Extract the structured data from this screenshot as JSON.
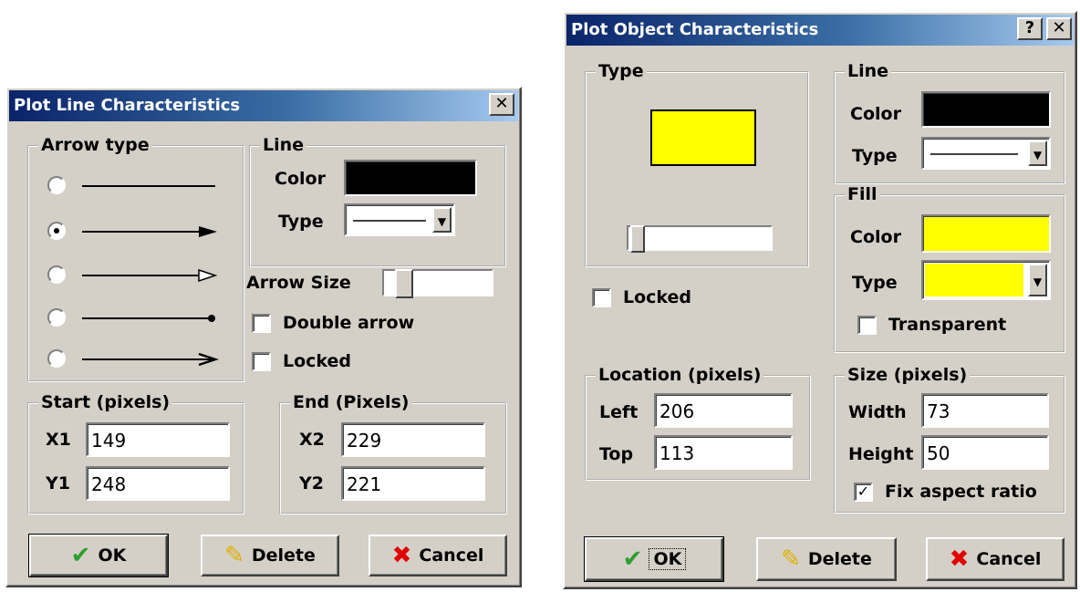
{
  "line_dialog": {
    "title": "Plot Line Characteristics",
    "close_glyph": "✕",
    "arrow_type": {
      "label": "Arrow type",
      "options": [
        "plain",
        "solid-head",
        "open-head",
        "dot-end",
        "barbed-head"
      ],
      "selected_index": 1
    },
    "line": {
      "label": "Line",
      "color_label": "Color",
      "color": "#000000",
      "type_label": "Type"
    },
    "arrow_size_label": "Arrow Size",
    "double_arrow_label": "Double arrow",
    "double_arrow_checked": false,
    "locked_label": "Locked",
    "locked_checked": false,
    "start": {
      "label": "Start (pixels)",
      "x_label": "X1",
      "x_value": "149",
      "y_label": "Y1",
      "y_value": "248"
    },
    "end": {
      "label": "End (Pixels)",
      "x_label": "X2",
      "x_value": "229",
      "y_label": "Y2",
      "y_value": "221"
    },
    "ok_label": "OK",
    "delete_label": "Delete",
    "cancel_label": "Cancel"
  },
  "object_dialog": {
    "title": "Plot Object Characteristics",
    "help_glyph": "?",
    "close_glyph": "✕",
    "type_label": "Type",
    "preview_fill": "#ffff00",
    "locked_label": "Locked",
    "locked_checked": false,
    "line": {
      "label": "Line",
      "color_label": "Color",
      "color": "#000000",
      "type_label": "Type"
    },
    "fill": {
      "label": "Fill",
      "color_label": "Color",
      "color": "#ffff00",
      "type_label": "Type",
      "transparent_label": "Transparent",
      "transparent_checked": false
    },
    "location": {
      "label": "Location (pixels)",
      "left_label": "Left",
      "left_value": "206",
      "top_label": "Top",
      "top_value": "113"
    },
    "size": {
      "label": "Size (pixels)",
      "width_label": "Width",
      "width_value": "73",
      "height_label": "Height",
      "height_value": "50",
      "fix_aspect_label": "Fix aspect ratio",
      "fix_aspect_checked": true
    },
    "ok_label": "OK",
    "delete_label": "Delete",
    "cancel_label": "Cancel"
  },
  "icons": {
    "ok": "check-icon",
    "delete": "eraser-icon",
    "cancel": "x-icon",
    "dropdown": "chevron-down-icon"
  },
  "colors": {
    "ok_icon": "#2e9e2e",
    "cancel_icon": "#e00000",
    "eraser_icon": "#e0b000"
  }
}
